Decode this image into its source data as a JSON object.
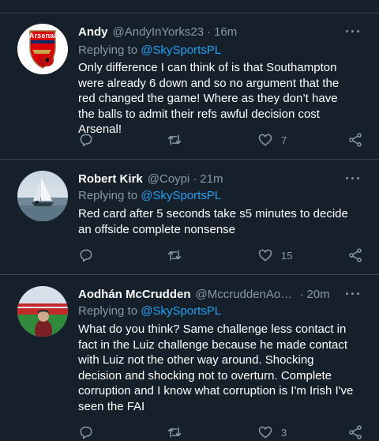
{
  "replying_prefix": "Replying to ",
  "more_label": "···",
  "colors": {
    "background": "#15202b",
    "accent": "#1da1f2",
    "secondary_text": "#8899a6",
    "divider": "#38444d"
  },
  "tweets": [
    {
      "name": "Andy",
      "handle": "@AndyInYorks23",
      "time": "16m",
      "reply_to": "@SkySportsPL",
      "text": "Only difference I can think of is that Southampton were already 6 down and so no argument that the red changed the game! Where as they don’t have the balls to admit their refs awful decision cost Arsenal!",
      "like_count": "7",
      "avatar_badge_text": "Arsenal"
    },
    {
      "name": "Robert Kirk",
      "handle": "@Coypi",
      "time": "21m",
      "reply_to": "@SkySportsPL",
      "text": "Red card after 5 seconds take s5 minutes to decide an offside complete nonsense",
      "like_count": "15"
    },
    {
      "name": "Aodhán McCrudden",
      "handle": "@MccruddenAod...",
      "time": "20m",
      "reply_to": "@SkySportsPL",
      "text": "What do you think? Same challenge less contact in fact in the Luiz challenge because he made contact with Luiz not the other way around. Shocking decision and shocking not to overturn. Complete corruption and I know what corruption is I'm Irish I've seen the FAI",
      "like_count": "3"
    }
  ]
}
